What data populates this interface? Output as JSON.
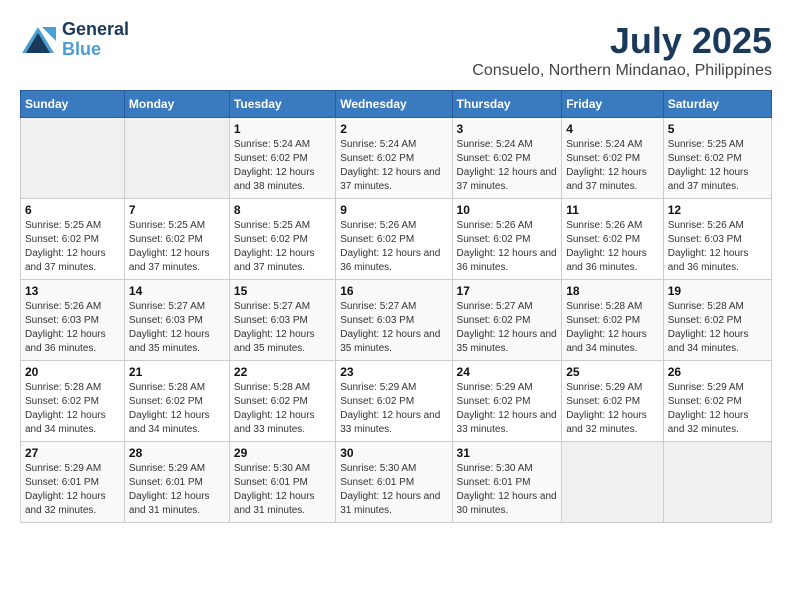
{
  "header": {
    "logo_line1": "General",
    "logo_line2": "Blue",
    "title": "July 2025",
    "subtitle": "Consuelo, Northern Mindanao, Philippines"
  },
  "weekdays": [
    "Sunday",
    "Monday",
    "Tuesday",
    "Wednesday",
    "Thursday",
    "Friday",
    "Saturday"
  ],
  "weeks": [
    [
      {
        "day": "",
        "empty": true
      },
      {
        "day": "",
        "empty": true
      },
      {
        "day": "1",
        "sunrise": "5:24 AM",
        "sunset": "6:02 PM",
        "daylight": "12 hours and 38 minutes."
      },
      {
        "day": "2",
        "sunrise": "5:24 AM",
        "sunset": "6:02 PM",
        "daylight": "12 hours and 37 minutes."
      },
      {
        "day": "3",
        "sunrise": "5:24 AM",
        "sunset": "6:02 PM",
        "daylight": "12 hours and 37 minutes."
      },
      {
        "day": "4",
        "sunrise": "5:24 AM",
        "sunset": "6:02 PM",
        "daylight": "12 hours and 37 minutes."
      },
      {
        "day": "5",
        "sunrise": "5:25 AM",
        "sunset": "6:02 PM",
        "daylight": "12 hours and 37 minutes."
      }
    ],
    [
      {
        "day": "6",
        "sunrise": "5:25 AM",
        "sunset": "6:02 PM",
        "daylight": "12 hours and 37 minutes."
      },
      {
        "day": "7",
        "sunrise": "5:25 AM",
        "sunset": "6:02 PM",
        "daylight": "12 hours and 37 minutes."
      },
      {
        "day": "8",
        "sunrise": "5:25 AM",
        "sunset": "6:02 PM",
        "daylight": "12 hours and 37 minutes."
      },
      {
        "day": "9",
        "sunrise": "5:26 AM",
        "sunset": "6:02 PM",
        "daylight": "12 hours and 36 minutes."
      },
      {
        "day": "10",
        "sunrise": "5:26 AM",
        "sunset": "6:02 PM",
        "daylight": "12 hours and 36 minutes."
      },
      {
        "day": "11",
        "sunrise": "5:26 AM",
        "sunset": "6:02 PM",
        "daylight": "12 hours and 36 minutes."
      },
      {
        "day": "12",
        "sunrise": "5:26 AM",
        "sunset": "6:03 PM",
        "daylight": "12 hours and 36 minutes."
      }
    ],
    [
      {
        "day": "13",
        "sunrise": "5:26 AM",
        "sunset": "6:03 PM",
        "daylight": "12 hours and 36 minutes."
      },
      {
        "day": "14",
        "sunrise": "5:27 AM",
        "sunset": "6:03 PM",
        "daylight": "12 hours and 35 minutes."
      },
      {
        "day": "15",
        "sunrise": "5:27 AM",
        "sunset": "6:03 PM",
        "daylight": "12 hours and 35 minutes."
      },
      {
        "day": "16",
        "sunrise": "5:27 AM",
        "sunset": "6:03 PM",
        "daylight": "12 hours and 35 minutes."
      },
      {
        "day": "17",
        "sunrise": "5:27 AM",
        "sunset": "6:02 PM",
        "daylight": "12 hours and 35 minutes."
      },
      {
        "day": "18",
        "sunrise": "5:28 AM",
        "sunset": "6:02 PM",
        "daylight": "12 hours and 34 minutes."
      },
      {
        "day": "19",
        "sunrise": "5:28 AM",
        "sunset": "6:02 PM",
        "daylight": "12 hours and 34 minutes."
      }
    ],
    [
      {
        "day": "20",
        "sunrise": "5:28 AM",
        "sunset": "6:02 PM",
        "daylight": "12 hours and 34 minutes."
      },
      {
        "day": "21",
        "sunrise": "5:28 AM",
        "sunset": "6:02 PM",
        "daylight": "12 hours and 34 minutes."
      },
      {
        "day": "22",
        "sunrise": "5:28 AM",
        "sunset": "6:02 PM",
        "daylight": "12 hours and 33 minutes."
      },
      {
        "day": "23",
        "sunrise": "5:29 AM",
        "sunset": "6:02 PM",
        "daylight": "12 hours and 33 minutes."
      },
      {
        "day": "24",
        "sunrise": "5:29 AM",
        "sunset": "6:02 PM",
        "daylight": "12 hours and 33 minutes."
      },
      {
        "day": "25",
        "sunrise": "5:29 AM",
        "sunset": "6:02 PM",
        "daylight": "12 hours and 32 minutes."
      },
      {
        "day": "26",
        "sunrise": "5:29 AM",
        "sunset": "6:02 PM",
        "daylight": "12 hours and 32 minutes."
      }
    ],
    [
      {
        "day": "27",
        "sunrise": "5:29 AM",
        "sunset": "6:01 PM",
        "daylight": "12 hours and 32 minutes."
      },
      {
        "day": "28",
        "sunrise": "5:29 AM",
        "sunset": "6:01 PM",
        "daylight": "12 hours and 31 minutes."
      },
      {
        "day": "29",
        "sunrise": "5:30 AM",
        "sunset": "6:01 PM",
        "daylight": "12 hours and 31 minutes."
      },
      {
        "day": "30",
        "sunrise": "5:30 AM",
        "sunset": "6:01 PM",
        "daylight": "12 hours and 31 minutes."
      },
      {
        "day": "31",
        "sunrise": "5:30 AM",
        "sunset": "6:01 PM",
        "daylight": "12 hours and 30 minutes."
      },
      {
        "day": "",
        "empty": true
      },
      {
        "day": "",
        "empty": true
      }
    ]
  ],
  "labels": {
    "sunrise_prefix": "Sunrise: ",
    "sunset_prefix": "Sunset: ",
    "daylight_prefix": "Daylight: "
  }
}
